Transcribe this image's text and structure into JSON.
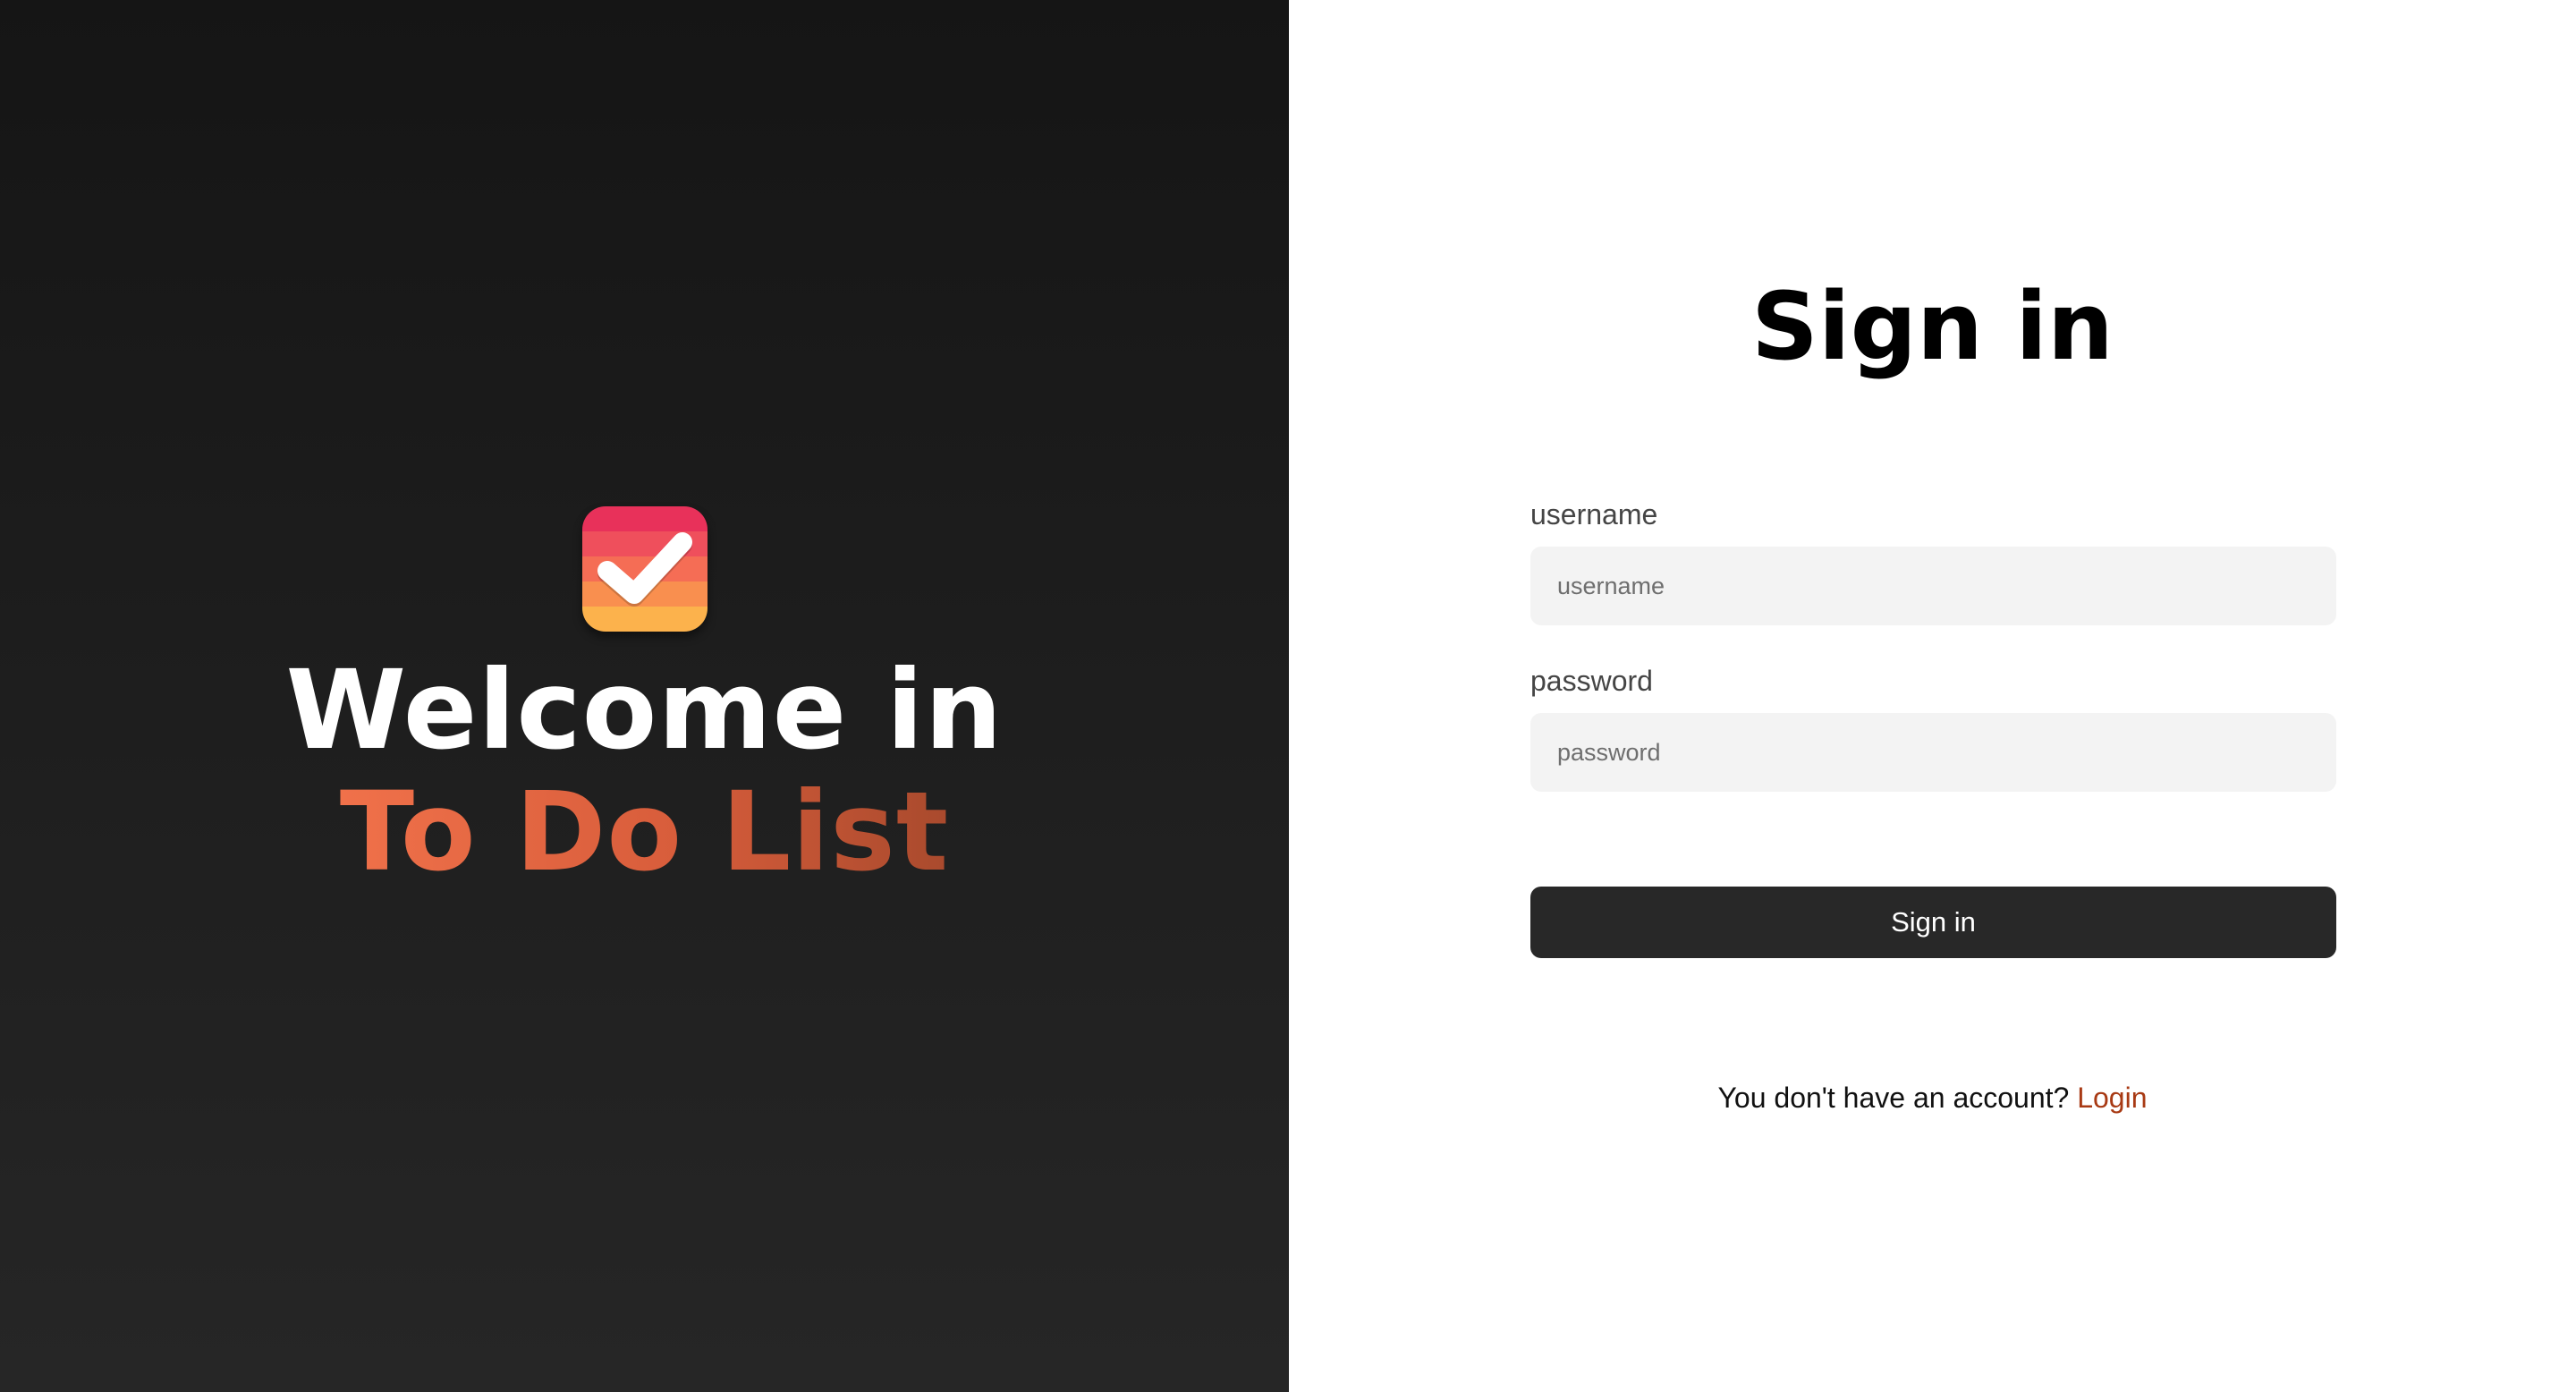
{
  "brand": {
    "icon": "checkmark-app-icon",
    "welcome_text": "Welcome in",
    "app_name": "To Do List",
    "colors": {
      "icon_bands": [
        "#e8315a",
        "#ef4f5c",
        "#f56d55",
        "#f98f4f",
        "#fcb24c"
      ],
      "app_name_gradient": [
        "#f0714a",
        "#a94a2d"
      ]
    }
  },
  "signin": {
    "title": "Sign in",
    "username": {
      "label": "username",
      "placeholder": "username",
      "value": ""
    },
    "password": {
      "label": "password",
      "placeholder": "password",
      "value": ""
    },
    "submit_label": "Sign in",
    "account_prompt": "You don't have an account?",
    "login_link": "Login",
    "colors": {
      "button": "#282828",
      "link": "#a83a14",
      "input_bg": "#f3f3f3"
    }
  }
}
